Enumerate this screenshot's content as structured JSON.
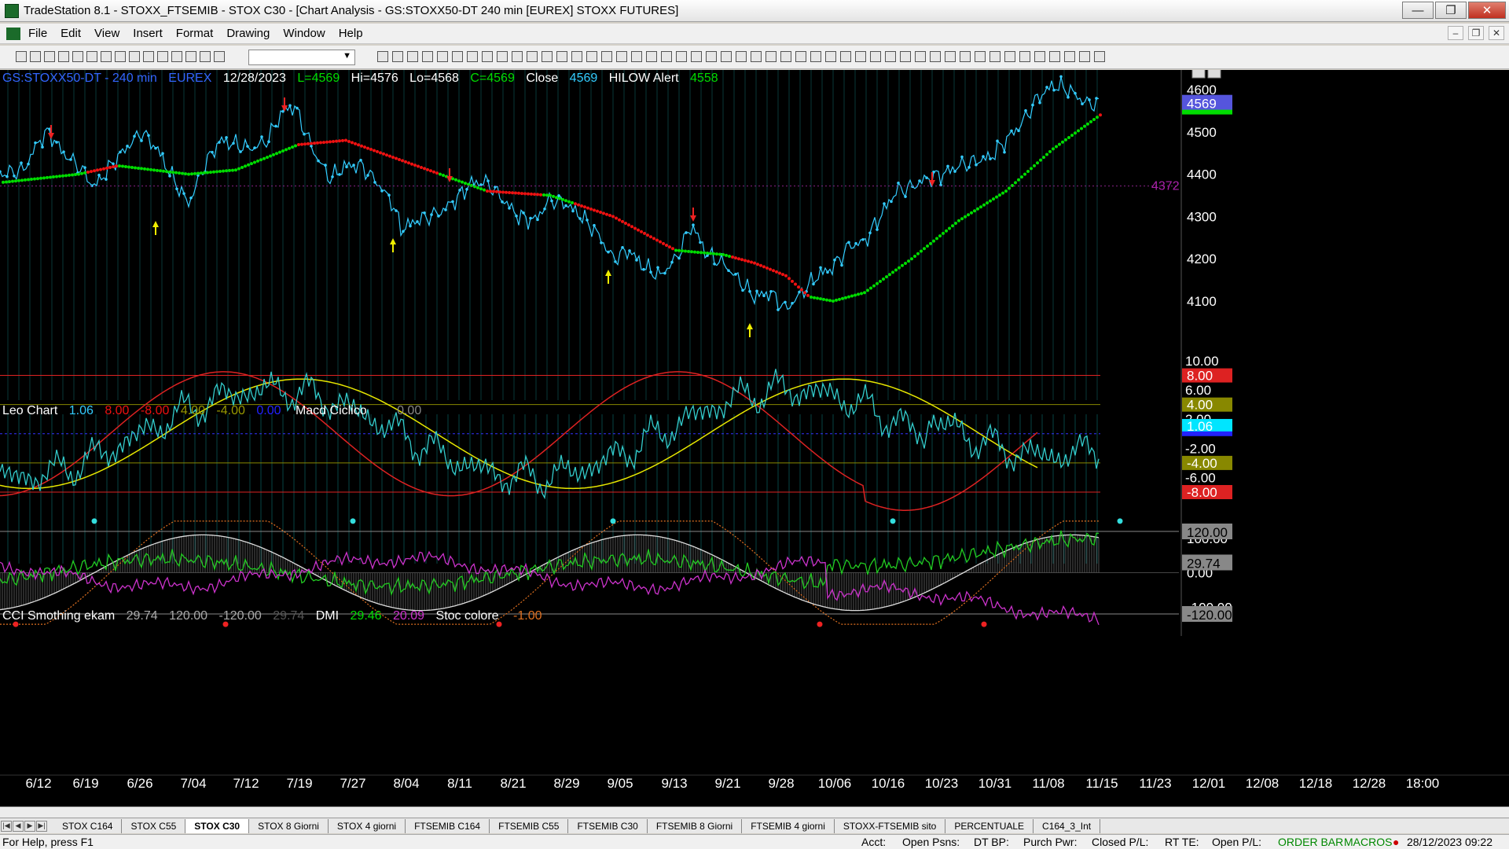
{
  "window": {
    "title": "TradeStation 8.1 - STOXX_FTSEMIB - STOX  C30 - [Chart Analysis - GS:STOXX50-DT  240 min  [EUREX] STOXX FUTURES]"
  },
  "menu": [
    "File",
    "Edit",
    "View",
    "Insert",
    "Format",
    "Drawing",
    "Window",
    "Help"
  ],
  "price_header": {
    "symbol": "GS:STOXX50-DT - 240 min",
    "exchange": "EUREX",
    "date": "12/28/2023",
    "last": "L=4569",
    "high": "Hi=4576",
    "low": "Lo=4568",
    "close": "C=4569",
    "ind1_name": "Close",
    "ind1_value": "4569",
    "ind2_name": "HILOW Alert",
    "ind2_value": "4558"
  },
  "leo_header": {
    "name": "Leo Chart",
    "v1": "1.06",
    "v2": "8.00",
    "v3": "-8.00",
    "v4": "4.00",
    "v5": "-4.00",
    "v6": "0.00",
    "name2": "Macd Ciclico",
    "v7": "0.00"
  },
  "cci_header": {
    "name": "CCI Smothing ekam",
    "v1": "29.74",
    "v2": "120.00",
    "v3": "-120.00",
    "v4": "29.74",
    "name2": "DMI",
    "v5": "29.46",
    "v6": "20.09",
    "name3": "Stoc colore",
    "v7": "-1.00"
  },
  "price_axis": {
    "ticks": [
      "4600",
      "4500",
      "4400",
      "4300",
      "4200",
      "4100"
    ],
    "last_label": "4569",
    "hline_label": "4372"
  },
  "leo_axis": {
    "ticks": [
      "10.00",
      "6.00",
      "2.00",
      "-2.00",
      "-6.00"
    ],
    "badges": [
      "8.00",
      "4.00",
      "1.06",
      "-4.00",
      "-8.00"
    ]
  },
  "cci_axis": {
    "ticks": [
      "100.00",
      "0.00",
      "-100.00"
    ],
    "badges": [
      "120.00",
      "29.74",
      "-120.00"
    ]
  },
  "date_axis": [
    "6/12",
    "6/19",
    "6/26",
    "7/04",
    "7/12",
    "7/19",
    "7/27",
    "8/04",
    "8/11",
    "8/21",
    "8/29",
    "9/05",
    "9/13",
    "9/21",
    "9/28",
    "10/06",
    "10/16",
    "10/23",
    "10/31",
    "11/08",
    "11/15",
    "11/23",
    "12/01",
    "12/08",
    "12/18",
    "12/28",
    "18:00"
  ],
  "tabs": [
    "STOX C164",
    "STOX C55",
    "STOX  C30",
    "STOX  8 Giorni",
    "STOX 4 giorni",
    "FTSEMIB C164",
    "FTSEMIB C55",
    "FTSEMIB C30",
    "FTSEMIB  8 Giorni",
    "FTSEMIB  4 giorni",
    "STOXX-FTSEMIB sito",
    "PERCENTUALE",
    "C164_3_Int"
  ],
  "active_tab": "STOX  C30",
  "status": {
    "help": "For Help, press F1",
    "acct": "Acct:",
    "open_psns": "Open Psns:",
    "dt_bp": "DT BP:",
    "purch_pwr": "Purch Pwr:",
    "closed_pl": "Closed P/L:",
    "rt_te": "RT TE:",
    "open_pl": "Open P/L:",
    "order_bar": "ORDER BAR",
    "macros": "MACROS",
    "datetime": "28/12/2023 09:22"
  },
  "colors": {
    "price": "#33ccff",
    "up_avg": "#00dd00",
    "down_avg": "#ee1111",
    "yellow": "#e6e600",
    "magenta": "#cc33cc",
    "orange": "#e07020"
  }
}
